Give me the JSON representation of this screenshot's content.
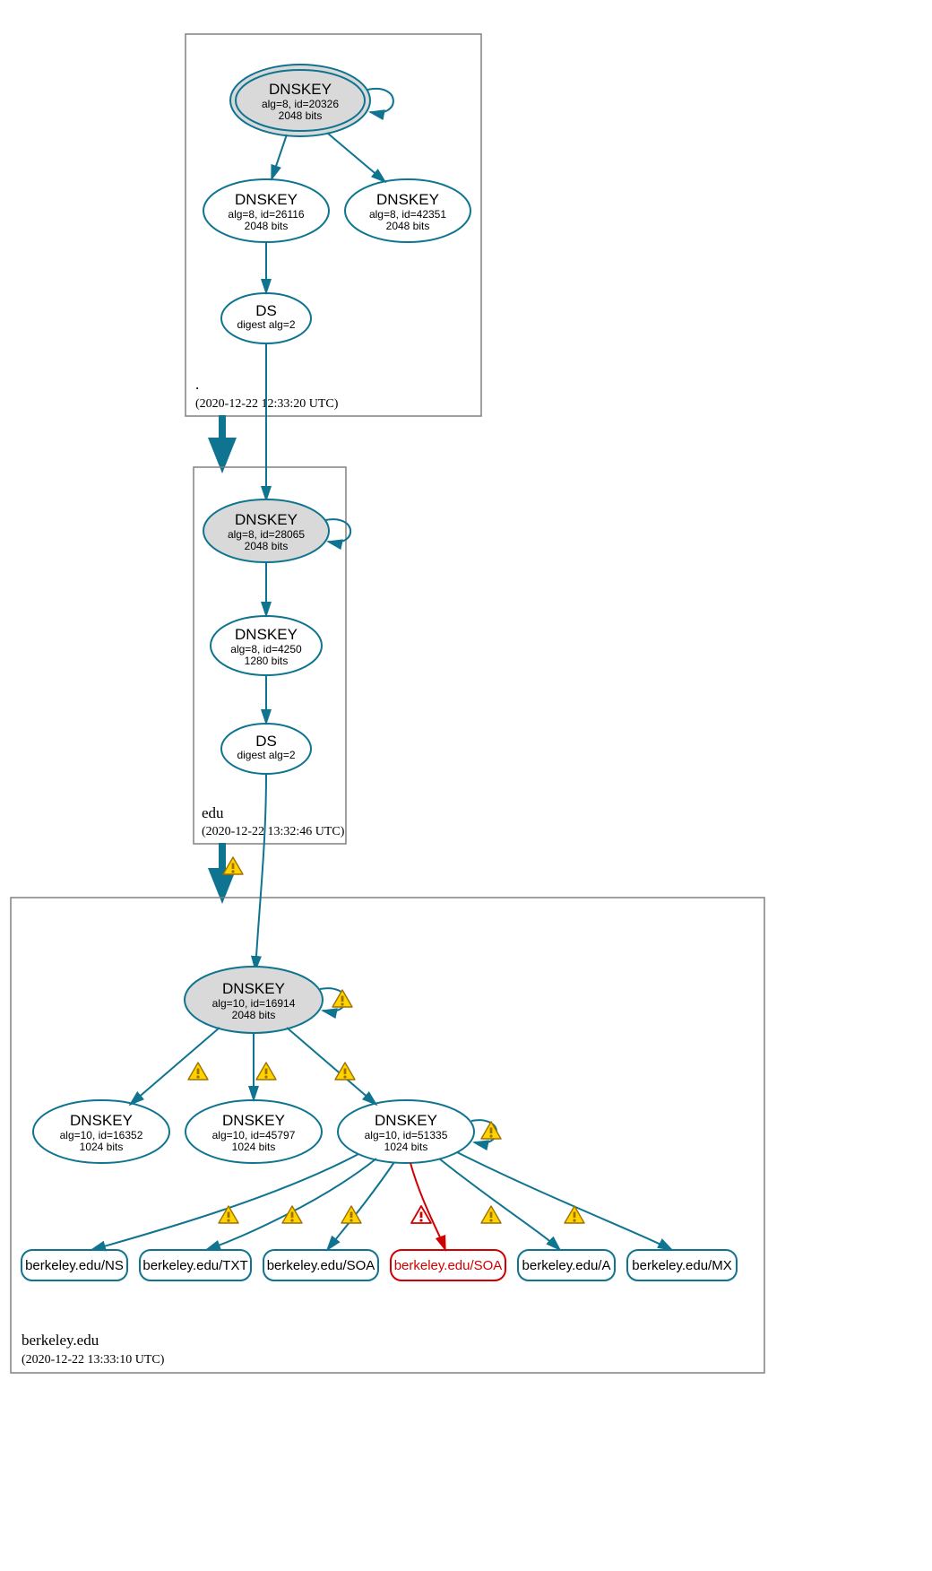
{
  "zones": {
    "root": {
      "label": ".",
      "timestamp": "(2020-12-22 12:33:20 UTC)"
    },
    "edu": {
      "label": "edu",
      "timestamp": "(2020-12-22 13:32:46 UTC)"
    },
    "berkeley": {
      "label": "berkeley.edu",
      "timestamp": "(2020-12-22 13:33:10 UTC)"
    }
  },
  "nodes": {
    "root_ksk": {
      "title": "DNSKEY",
      "sub1": "alg=8, id=20326",
      "sub2": "2048 bits"
    },
    "root_zsk1": {
      "title": "DNSKEY",
      "sub1": "alg=8, id=26116",
      "sub2": "2048 bits"
    },
    "root_zsk2": {
      "title": "DNSKEY",
      "sub1": "alg=8, id=42351",
      "sub2": "2048 bits"
    },
    "root_ds": {
      "title": "DS",
      "sub1": "digest alg=2"
    },
    "edu_ksk": {
      "title": "DNSKEY",
      "sub1": "alg=8, id=28065",
      "sub2": "2048 bits"
    },
    "edu_zsk": {
      "title": "DNSKEY",
      "sub1": "alg=8, id=4250",
      "sub2": "1280 bits"
    },
    "edu_ds": {
      "title": "DS",
      "sub1": "digest alg=2"
    },
    "b_ksk": {
      "title": "DNSKEY",
      "sub1": "alg=10, id=16914",
      "sub2": "2048 bits"
    },
    "b_z1": {
      "title": "DNSKEY",
      "sub1": "alg=10, id=16352",
      "sub2": "1024 bits"
    },
    "b_z2": {
      "title": "DNSKEY",
      "sub1": "alg=10, id=45797",
      "sub2": "1024 bits"
    },
    "b_z3": {
      "title": "DNSKEY",
      "sub1": "alg=10, id=51335",
      "sub2": "1024 bits"
    }
  },
  "rr": {
    "ns": "berkeley.edu/NS",
    "txt": "berkeley.edu/TXT",
    "soa1": "berkeley.edu/SOA",
    "soa2": "berkeley.edu/SOA",
    "a": "berkeley.edu/A",
    "mx": "berkeley.edu/MX"
  }
}
